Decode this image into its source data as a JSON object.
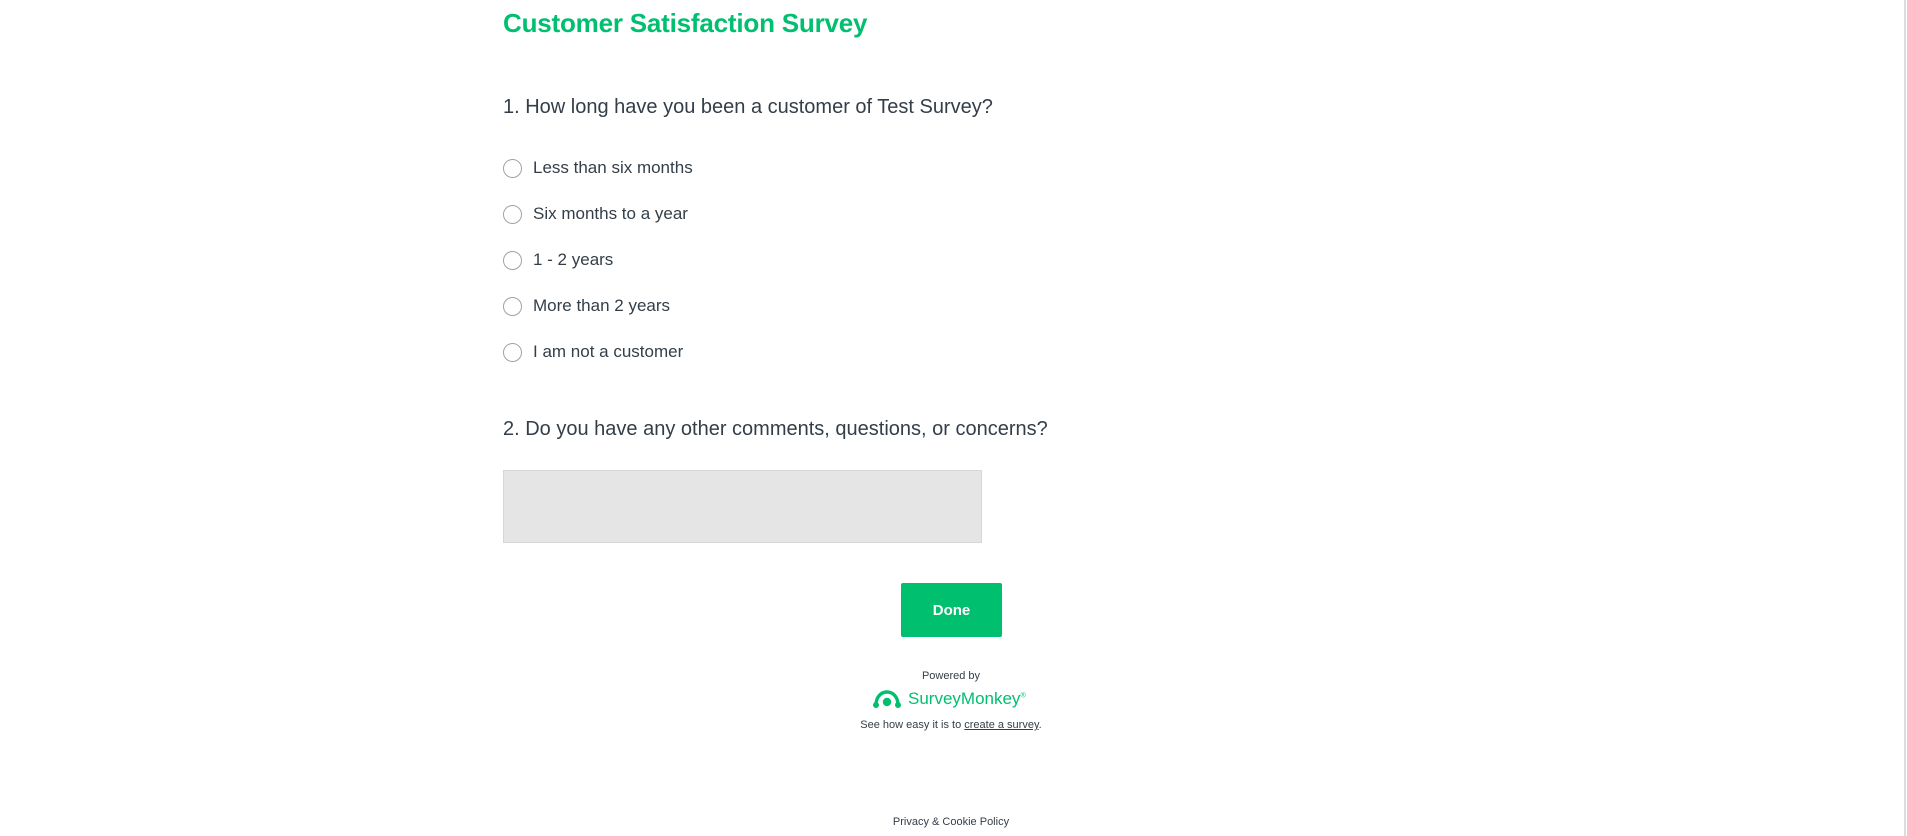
{
  "survey": {
    "title": "Customer Satisfaction Survey"
  },
  "questions": [
    {
      "title": "1. How long have you been a customer of Test Survey?",
      "options": [
        "Less than six months",
        "Six months to a year",
        "1 - 2 years",
        "More than 2 years",
        "I am not a customer"
      ]
    },
    {
      "title": "2. Do you have any other comments, questions, or concerns?",
      "comment_value": ""
    }
  ],
  "actions": {
    "done_label": "Done"
  },
  "footer": {
    "powered_by": "Powered by",
    "brand_name": "SurveyMonkey",
    "brand_mark": "®",
    "tagline_prefix": "See how easy it is to ",
    "tagline_link": "create a survey",
    "tagline_suffix": ".",
    "privacy_label": "Privacy & Cookie Policy"
  },
  "colors": {
    "accent": "#00bf6f",
    "text": "#333e48",
    "comment_box": "#e5e5e5"
  },
  "icons": {
    "brand_logo": "surveymonkey-logo-icon",
    "radio": "radio-unselected-icon"
  }
}
